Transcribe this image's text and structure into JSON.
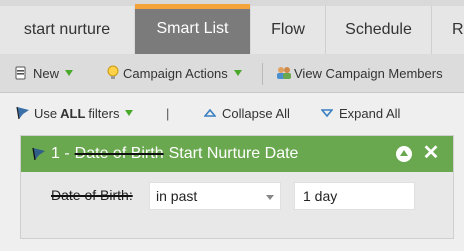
{
  "tabs": [
    {
      "label": "start nurture",
      "active": false
    },
    {
      "label": "Smart List",
      "active": true
    },
    {
      "label": "Flow",
      "active": false
    },
    {
      "label": "Schedule",
      "active": false
    },
    {
      "label": "Re",
      "active": false
    }
  ],
  "toolbar": {
    "new_label": "New",
    "campaign_actions_label": "Campaign Actions",
    "view_members_label": "View Campaign Members"
  },
  "options": {
    "use_label": "Use",
    "all_label": "ALL",
    "filters_label": "filters",
    "separator": "|",
    "collapse_label": "Collapse All",
    "expand_label": "Expand All"
  },
  "filter": {
    "index": "1 -",
    "old_name": "Date of Birth",
    "new_name": "Start Nurture Date",
    "field_label": "Date of Birth:",
    "operator": "in past",
    "value": "1 day"
  },
  "colors": {
    "accent_tab": "#f4a33b",
    "filter_header": "#6aa84f",
    "caret_green": "#4aa82a"
  }
}
